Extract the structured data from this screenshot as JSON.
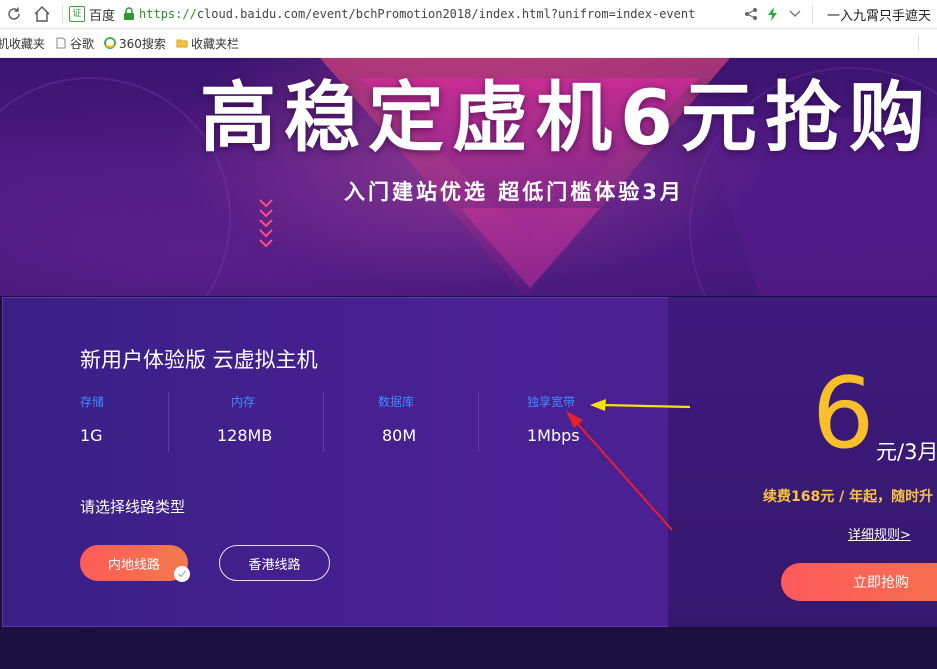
{
  "browser": {
    "site_badge": "证",
    "site_name": "百度",
    "url_scheme": "https://",
    "url_rest": "cloud.baidu.com/event/bchPromotion2018/index.html?unifrom=index-event",
    "search_text": "一入九霄只手遮天"
  },
  "bookmarks": [
    {
      "label": "机收藏夹",
      "icon": "folder-icon"
    },
    {
      "label": "谷歌",
      "icon": "page-icon"
    },
    {
      "label": "360搜索",
      "icon": "360-logo-icon"
    },
    {
      "label": "收藏夹栏",
      "icon": "folder-icon"
    }
  ],
  "banner": {
    "title": "高稳定虚机6元抢购",
    "subtitle": "入门建站优选 超低门槛体验3月"
  },
  "product": {
    "title": "新用户体验版 云虚拟主机",
    "specs": [
      {
        "label": "存储",
        "value": "1G"
      },
      {
        "label": "内存",
        "value": "128MB"
      },
      {
        "label": "数据库",
        "value": "80M"
      },
      {
        "label": "独享宽带",
        "value": "1Mbps"
      }
    ],
    "route_label": "请选择线路类型",
    "routes": [
      {
        "label": "内地线路",
        "selected": true
      },
      {
        "label": "香港线路",
        "selected": false
      }
    ]
  },
  "price": {
    "amount": "6",
    "unit": "元/3月",
    "renew": "续费168元 / 年起，随时升",
    "rules_link": "详细规则>",
    "buy_label": "立即抢购"
  },
  "colors": {
    "accent_orange": "#ff5b59",
    "price_gold": "#f7c02b",
    "spec_label_blue": "#3d8cff",
    "annotation_yellow": "#f5e400",
    "annotation_red": "#e8202a"
  }
}
